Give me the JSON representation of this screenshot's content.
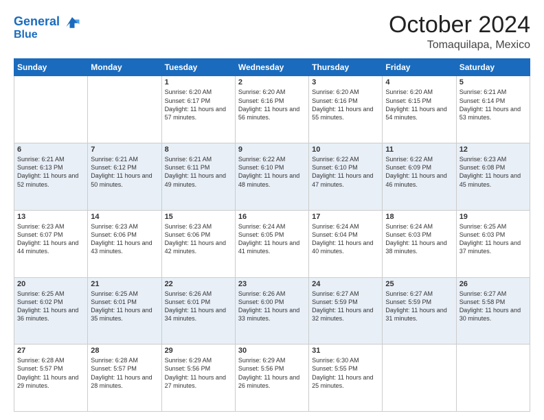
{
  "header": {
    "logo_line1": "General",
    "logo_line2": "Blue",
    "month": "October 2024",
    "location": "Tomaquilapa, Mexico"
  },
  "weekdays": [
    "Sunday",
    "Monday",
    "Tuesday",
    "Wednesday",
    "Thursday",
    "Friday",
    "Saturday"
  ],
  "weeks": [
    [
      {
        "day": "",
        "sunrise": "",
        "sunset": "",
        "daylight": ""
      },
      {
        "day": "",
        "sunrise": "",
        "sunset": "",
        "daylight": ""
      },
      {
        "day": "1",
        "sunrise": "Sunrise: 6:20 AM",
        "sunset": "Sunset: 6:17 PM",
        "daylight": "Daylight: 11 hours and 57 minutes."
      },
      {
        "day": "2",
        "sunrise": "Sunrise: 6:20 AM",
        "sunset": "Sunset: 6:16 PM",
        "daylight": "Daylight: 11 hours and 56 minutes."
      },
      {
        "day": "3",
        "sunrise": "Sunrise: 6:20 AM",
        "sunset": "Sunset: 6:16 PM",
        "daylight": "Daylight: 11 hours and 55 minutes."
      },
      {
        "day": "4",
        "sunrise": "Sunrise: 6:20 AM",
        "sunset": "Sunset: 6:15 PM",
        "daylight": "Daylight: 11 hours and 54 minutes."
      },
      {
        "day": "5",
        "sunrise": "Sunrise: 6:21 AM",
        "sunset": "Sunset: 6:14 PM",
        "daylight": "Daylight: 11 hours and 53 minutes."
      }
    ],
    [
      {
        "day": "6",
        "sunrise": "Sunrise: 6:21 AM",
        "sunset": "Sunset: 6:13 PM",
        "daylight": "Daylight: 11 hours and 52 minutes."
      },
      {
        "day": "7",
        "sunrise": "Sunrise: 6:21 AM",
        "sunset": "Sunset: 6:12 PM",
        "daylight": "Daylight: 11 hours and 50 minutes."
      },
      {
        "day": "8",
        "sunrise": "Sunrise: 6:21 AM",
        "sunset": "Sunset: 6:11 PM",
        "daylight": "Daylight: 11 hours and 49 minutes."
      },
      {
        "day": "9",
        "sunrise": "Sunrise: 6:22 AM",
        "sunset": "Sunset: 6:10 PM",
        "daylight": "Daylight: 11 hours and 48 minutes."
      },
      {
        "day": "10",
        "sunrise": "Sunrise: 6:22 AM",
        "sunset": "Sunset: 6:10 PM",
        "daylight": "Daylight: 11 hours and 47 minutes."
      },
      {
        "day": "11",
        "sunrise": "Sunrise: 6:22 AM",
        "sunset": "Sunset: 6:09 PM",
        "daylight": "Daylight: 11 hours and 46 minutes."
      },
      {
        "day": "12",
        "sunrise": "Sunrise: 6:23 AM",
        "sunset": "Sunset: 6:08 PM",
        "daylight": "Daylight: 11 hours and 45 minutes."
      }
    ],
    [
      {
        "day": "13",
        "sunrise": "Sunrise: 6:23 AM",
        "sunset": "Sunset: 6:07 PM",
        "daylight": "Daylight: 11 hours and 44 minutes."
      },
      {
        "day": "14",
        "sunrise": "Sunrise: 6:23 AM",
        "sunset": "Sunset: 6:06 PM",
        "daylight": "Daylight: 11 hours and 43 minutes."
      },
      {
        "day": "15",
        "sunrise": "Sunrise: 6:23 AM",
        "sunset": "Sunset: 6:06 PM",
        "daylight": "Daylight: 11 hours and 42 minutes."
      },
      {
        "day": "16",
        "sunrise": "Sunrise: 6:24 AM",
        "sunset": "Sunset: 6:05 PM",
        "daylight": "Daylight: 11 hours and 41 minutes."
      },
      {
        "day": "17",
        "sunrise": "Sunrise: 6:24 AM",
        "sunset": "Sunset: 6:04 PM",
        "daylight": "Daylight: 11 hours and 40 minutes."
      },
      {
        "day": "18",
        "sunrise": "Sunrise: 6:24 AM",
        "sunset": "Sunset: 6:03 PM",
        "daylight": "Daylight: 11 hours and 38 minutes."
      },
      {
        "day": "19",
        "sunrise": "Sunrise: 6:25 AM",
        "sunset": "Sunset: 6:03 PM",
        "daylight": "Daylight: 11 hours and 37 minutes."
      }
    ],
    [
      {
        "day": "20",
        "sunrise": "Sunrise: 6:25 AM",
        "sunset": "Sunset: 6:02 PM",
        "daylight": "Daylight: 11 hours and 36 minutes."
      },
      {
        "day": "21",
        "sunrise": "Sunrise: 6:25 AM",
        "sunset": "Sunset: 6:01 PM",
        "daylight": "Daylight: 11 hours and 35 minutes."
      },
      {
        "day": "22",
        "sunrise": "Sunrise: 6:26 AM",
        "sunset": "Sunset: 6:01 PM",
        "daylight": "Daylight: 11 hours and 34 minutes."
      },
      {
        "day": "23",
        "sunrise": "Sunrise: 6:26 AM",
        "sunset": "Sunset: 6:00 PM",
        "daylight": "Daylight: 11 hours and 33 minutes."
      },
      {
        "day": "24",
        "sunrise": "Sunrise: 6:27 AM",
        "sunset": "Sunset: 5:59 PM",
        "daylight": "Daylight: 11 hours and 32 minutes."
      },
      {
        "day": "25",
        "sunrise": "Sunrise: 6:27 AM",
        "sunset": "Sunset: 5:59 PM",
        "daylight": "Daylight: 11 hours and 31 minutes."
      },
      {
        "day": "26",
        "sunrise": "Sunrise: 6:27 AM",
        "sunset": "Sunset: 5:58 PM",
        "daylight": "Daylight: 11 hours and 30 minutes."
      }
    ],
    [
      {
        "day": "27",
        "sunrise": "Sunrise: 6:28 AM",
        "sunset": "Sunset: 5:57 PM",
        "daylight": "Daylight: 11 hours and 29 minutes."
      },
      {
        "day": "28",
        "sunrise": "Sunrise: 6:28 AM",
        "sunset": "Sunset: 5:57 PM",
        "daylight": "Daylight: 11 hours and 28 minutes."
      },
      {
        "day": "29",
        "sunrise": "Sunrise: 6:29 AM",
        "sunset": "Sunset: 5:56 PM",
        "daylight": "Daylight: 11 hours and 27 minutes."
      },
      {
        "day": "30",
        "sunrise": "Sunrise: 6:29 AM",
        "sunset": "Sunset: 5:56 PM",
        "daylight": "Daylight: 11 hours and 26 minutes."
      },
      {
        "day": "31",
        "sunrise": "Sunrise: 6:30 AM",
        "sunset": "Sunset: 5:55 PM",
        "daylight": "Daylight: 11 hours and 25 minutes."
      },
      {
        "day": "",
        "sunrise": "",
        "sunset": "",
        "daylight": ""
      },
      {
        "day": "",
        "sunrise": "",
        "sunset": "",
        "daylight": ""
      }
    ]
  ]
}
